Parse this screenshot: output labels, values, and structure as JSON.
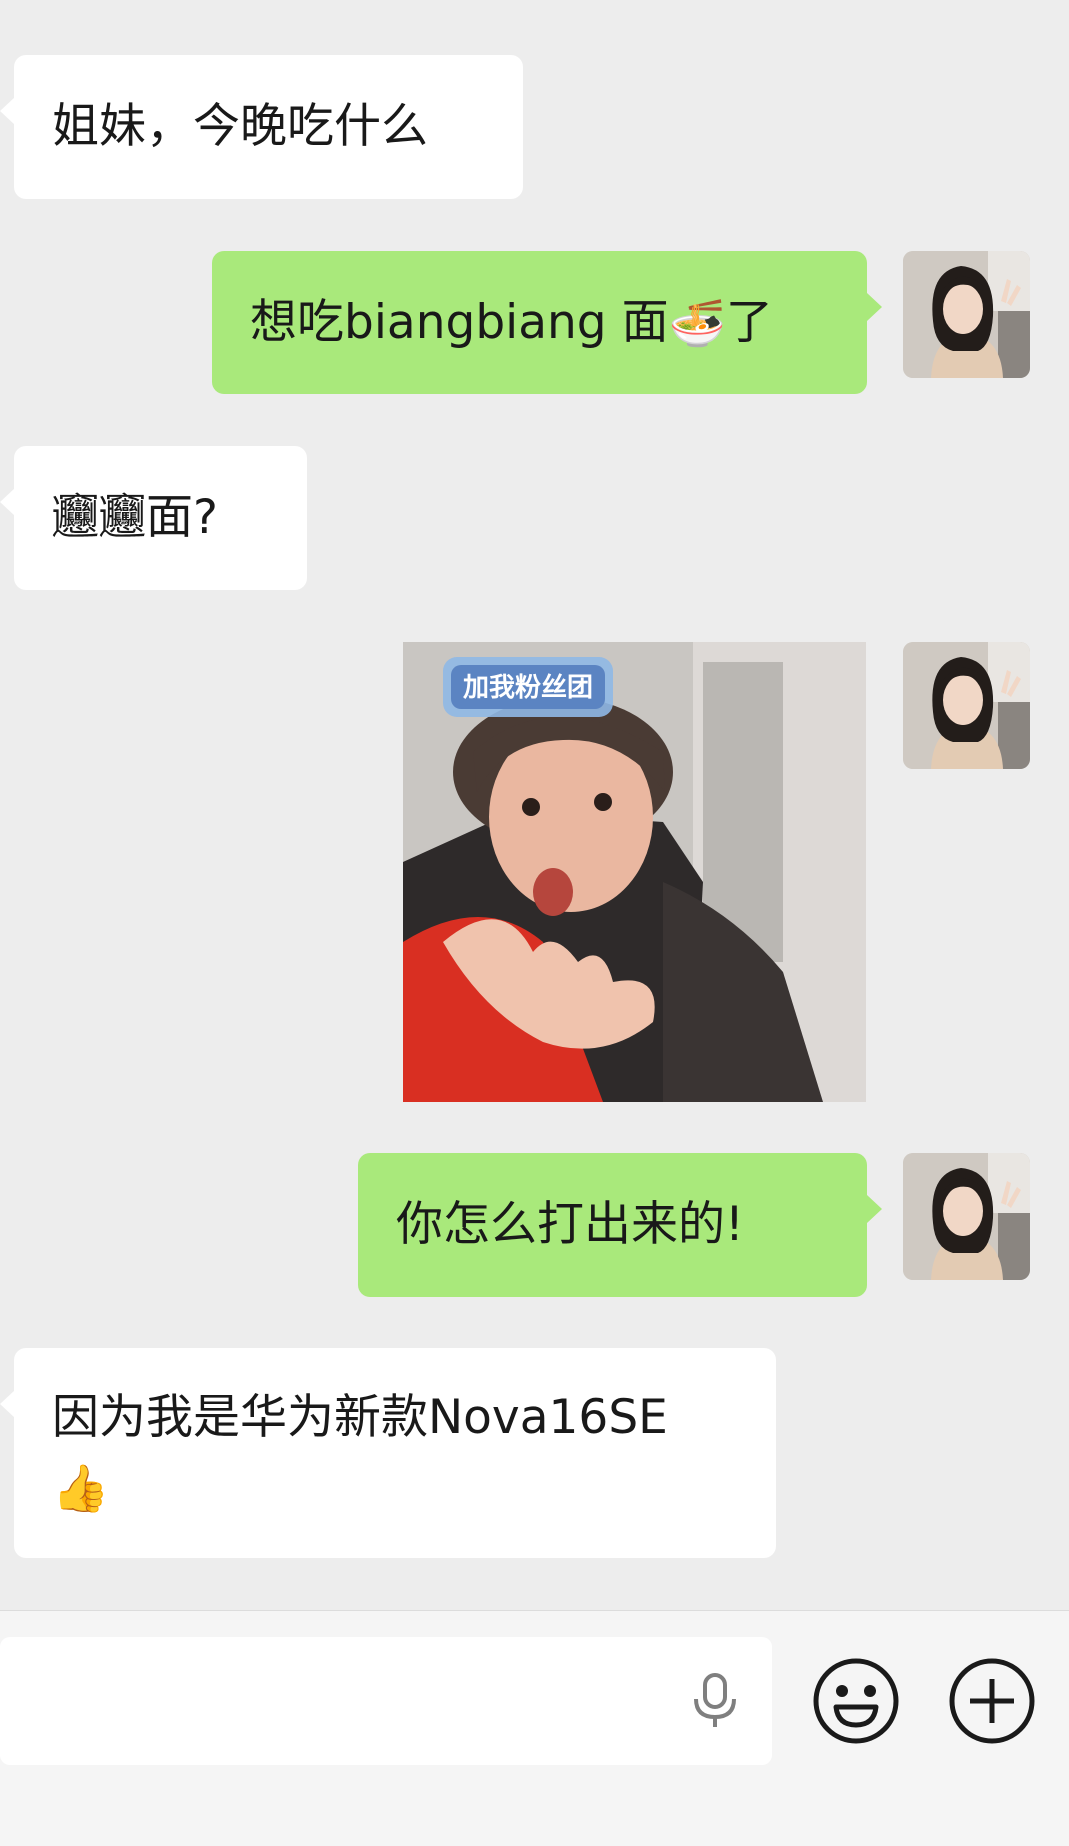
{
  "messages": [
    {
      "side": "in",
      "text": "姐妹，今晚吃什么"
    },
    {
      "side": "out",
      "text_before": "想吃biangbiang 面",
      "emoji": "🍜",
      "text_after": "了"
    },
    {
      "side": "in",
      "text": "𰻞𰻞面?"
    },
    {
      "side": "out",
      "type": "sticker",
      "sticker_caption": "加我粉丝团"
    },
    {
      "side": "out",
      "text": "你怎么打出来的!"
    },
    {
      "side": "in",
      "text": "因为我是华为新款Nova16SE",
      "emoji": "👍"
    }
  ],
  "input": {
    "value": "",
    "placeholder": ""
  },
  "icons": {
    "voice": "microphone-icon",
    "emoji": "smiley-icon",
    "more": "plus-circle-icon"
  },
  "colors": {
    "background": "#ededed",
    "incoming_bubble": "#ffffff",
    "outgoing_bubble": "#a9e97b",
    "input_bar": "#f5f5f5"
  }
}
